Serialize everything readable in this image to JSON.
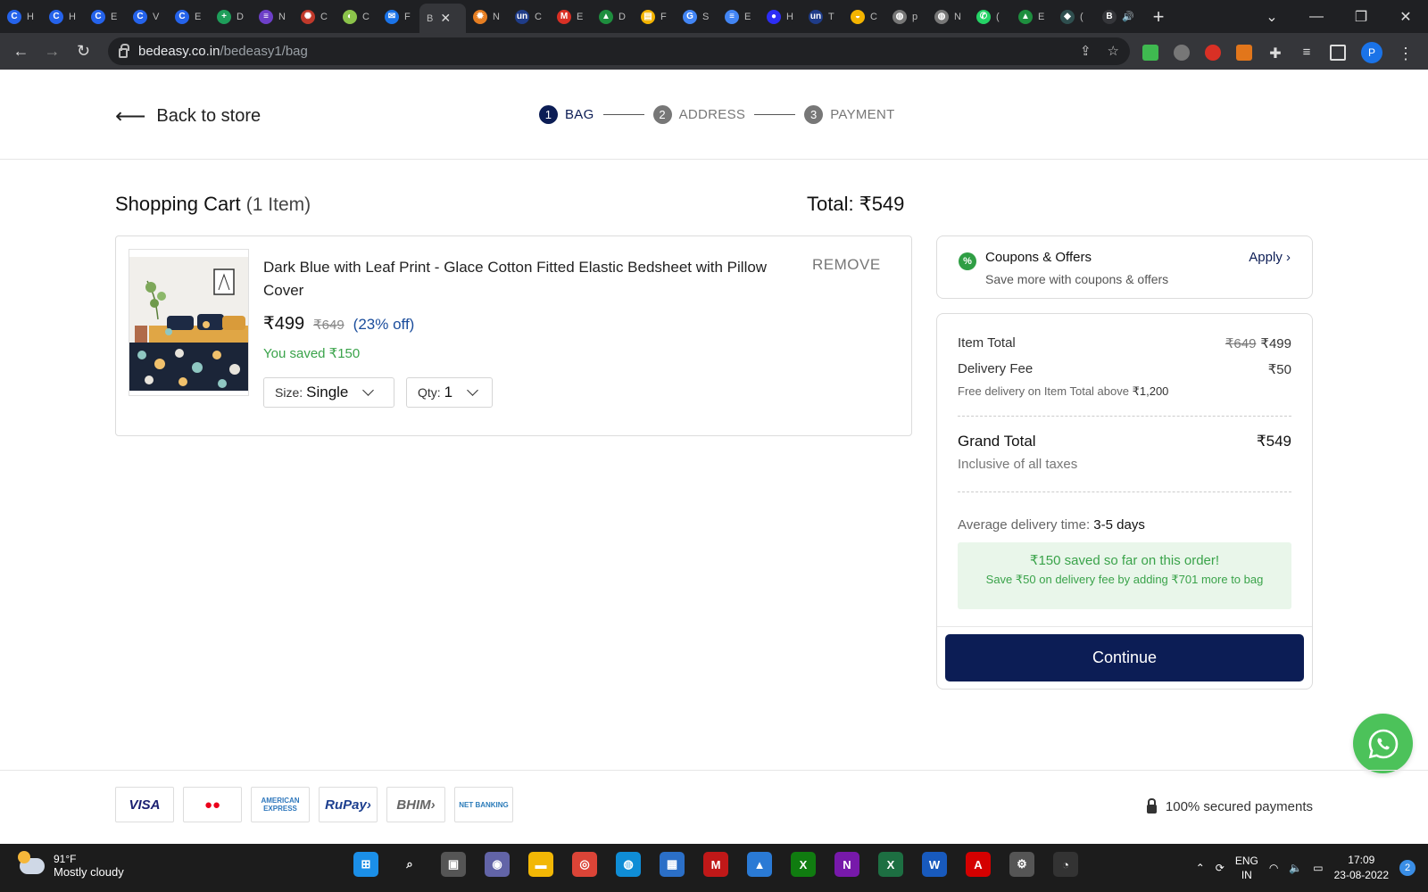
{
  "browser": {
    "tabs": [
      {
        "letter": "C",
        "color": "#2563eb",
        "label": "H"
      },
      {
        "letter": "C",
        "color": "#2563eb",
        "label": "H"
      },
      {
        "letter": "C",
        "color": "#2563eb",
        "label": "E"
      },
      {
        "letter": "C",
        "color": "#2563eb",
        "label": "V"
      },
      {
        "letter": "C",
        "color": "#2563eb",
        "label": "E"
      },
      {
        "letter": "+",
        "color": "#1e9e5a",
        "label": "D"
      },
      {
        "letter": "≡",
        "color": "#6d3fc8",
        "label": "N"
      },
      {
        "letter": "✺",
        "color": "#c0392b",
        "label": "C"
      },
      {
        "letter": "◐",
        "color": "#8bc34a",
        "label": "C"
      },
      {
        "letter": "✉",
        "color": "#1a73e8",
        "label": "F"
      }
    ],
    "active_tab": {
      "label": "B"
    },
    "tabs_right": [
      {
        "letter": "✹",
        "color": "#e67e22",
        "label": "N"
      },
      {
        "letter": "un",
        "color": "#1f3c88",
        "label": "C"
      },
      {
        "letter": "M",
        "color": "#d93025",
        "label": "E"
      },
      {
        "letter": "▲",
        "color": "#1e8e3e",
        "label": "D"
      },
      {
        "letter": "▤",
        "color": "#f4b400",
        "label": "F"
      },
      {
        "letter": "G",
        "color": "#4285f4",
        "label": "S"
      },
      {
        "letter": "≡",
        "color": "#4285f4",
        "label": "E"
      },
      {
        "letter": "●",
        "color": "#2d2df5",
        "label": "H"
      },
      {
        "letter": "un",
        "color": "#1f3c88",
        "label": "T"
      },
      {
        "letter": "◒",
        "color": "#f4b400",
        "label": "C"
      },
      {
        "letter": "◍",
        "color": "#777777",
        "label": "p"
      },
      {
        "letter": "◍",
        "color": "#777777",
        "label": "N"
      },
      {
        "letter": "✆",
        "color": "#25d366",
        "label": "("
      },
      {
        "letter": "▲",
        "color": "#1e8e3e",
        "label": "E"
      },
      {
        "letter": "◆",
        "color": "#2f4f4f",
        "label": "("
      },
      {
        "letter": "B",
        "color": "#35363a",
        "label": "🔊"
      }
    ],
    "url_host": "bedeasy.co.in",
    "url_path": "/bedeasy1/bag",
    "profile_initial": "P"
  },
  "header": {
    "back_label": "Back to store",
    "steps": [
      {
        "num": "1",
        "label": "BAG"
      },
      {
        "num": "2",
        "label": "ADDRESS"
      },
      {
        "num": "3",
        "label": "PAYMENT"
      }
    ]
  },
  "cart": {
    "title": "Shopping Cart",
    "count": "(1 Item)",
    "total": "Total: ₹549",
    "item": {
      "name": "Dark Blue with Leaf Print - Glace Cotton Fitted Elastic Bedsheet with Pillow Cover",
      "remove": "REMOVE",
      "price": "₹499",
      "mrp": "₹649",
      "discount": "(23% off)",
      "saved": "You saved ₹150",
      "size_label": "Size:",
      "size_value": "Single",
      "qty_label": "Qty:",
      "qty_value": "1"
    }
  },
  "coupon": {
    "icon": "%",
    "title": "Coupons & Offers",
    "subtitle": "Save more with coupons & offers",
    "apply": "Apply"
  },
  "summary": {
    "item_total_label": "Item Total",
    "item_total_mrp": "₹649",
    "item_total_value": "₹499",
    "delivery_label": "Delivery Fee",
    "delivery_value": "₹50",
    "free_note": "Free delivery on Item Total above",
    "free_threshold": "₹1,200",
    "grand_label": "Grand Total",
    "grand_value": "₹549",
    "inclusive": "Inclusive of all taxes",
    "avg_label": "Average delivery time:",
    "avg_value": "3-5 days",
    "saved_big": "₹150 saved so far on this order!",
    "saved_small": "Save ₹50 on delivery fee by adding ₹701 more to bag",
    "continue": "Continue"
  },
  "footer": {
    "payment_logos": [
      {
        "text": "VISA",
        "color": "#1a1f71"
      },
      {
        "text": "●●",
        "color": "#eb001b"
      },
      {
        "text": "AMERICAN EXPRESS",
        "color": "#2e77bc"
      },
      {
        "text": "RuPay›",
        "color": "#1d3f8f"
      },
      {
        "text": "BHIM›",
        "color": "#666666"
      },
      {
        "text": "NET BANKING",
        "color": "#2b7bb9"
      }
    ],
    "secure": "100% secured payments"
  },
  "taskbar": {
    "temp": "91°F",
    "condition": "Mostly cloudy",
    "apps": [
      {
        "glyph": "⊞",
        "color": "#1b8fe8"
      },
      {
        "glyph": "⌕",
        "color": "#1c1c1c"
      },
      {
        "glyph": "▣",
        "color": "#555555"
      },
      {
        "glyph": "◉",
        "color": "#6264a7"
      },
      {
        "glyph": "▬",
        "color": "#f2b705"
      },
      {
        "glyph": "◎",
        "color": "#db4437"
      },
      {
        "glyph": "◍",
        "color": "#0f8dd6"
      },
      {
        "glyph": "▦",
        "color": "#2b6fc7"
      },
      {
        "glyph": "M",
        "color": "#c01818"
      },
      {
        "glyph": "▲",
        "color": "#2a7ad5"
      },
      {
        "glyph": "X",
        "color": "#107c10"
      },
      {
        "glyph": "N",
        "color": "#7719aa"
      },
      {
        "glyph": "X",
        "color": "#1d6f42"
      },
      {
        "glyph": "W",
        "color": "#185abd"
      },
      {
        "glyph": "A",
        "color": "#d40000"
      },
      {
        "glyph": "⚙",
        "color": "#555555"
      },
      {
        "glyph": "◔",
        "color": "#333333"
      }
    ],
    "lang_top": "ENG",
    "lang_bottom": "IN",
    "time": "17:09",
    "date": "23-08-2022",
    "notifications": "2"
  }
}
